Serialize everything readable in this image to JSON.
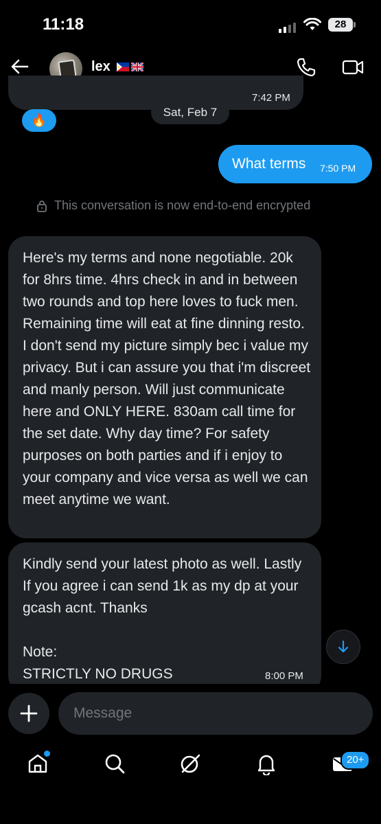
{
  "status_bar": {
    "time": "11:18",
    "battery": "28"
  },
  "header": {
    "contact_name": "lex",
    "flags": [
      "philippines-flag",
      "uk-flag"
    ]
  },
  "colors": {
    "accent": "#1d9bf0",
    "bubble_incoming": "#202327",
    "background": "#000000"
  },
  "messages": {
    "prev_time": "7:42 PM",
    "date_separator": "Sat, Feb 7",
    "reaction": "🔥",
    "outgoing": {
      "text": "What terms",
      "time": "7:50 PM"
    },
    "encryption_notice": "This conversation is now end-to-end encrypted",
    "incoming_1": {
      "text": "Here's my terms and none negotiable. 20k for 8hrs time. 4hrs check in and in between two rounds and top here loves to fuck men. Remaining time will eat at fine dinning resto. I don't send my picture simply bec i value my privacy. But i can assure you that i'm discreet and manly person. Will just communicate here and ONLY HERE. 830am call time for the set date. Why day time? For safety purposes on both parties and if i enjoy to your company and vice versa as well we can meet anytime we want."
    },
    "incoming_2": {
      "text": "Kindly send your latest photo as well. Lastly If you agree i can send 1k as my dp at your gcash acnt.  Thanks\n\nNote:\nSTRICTLY NO DRUGS",
      "time": "8:00 PM"
    }
  },
  "composer": {
    "placeholder": "Message"
  },
  "tab_bar": {
    "items": [
      "home-icon",
      "search-icon",
      "grok-icon",
      "notifications-icon",
      "messages-icon"
    ],
    "messages_badge": "20+"
  }
}
